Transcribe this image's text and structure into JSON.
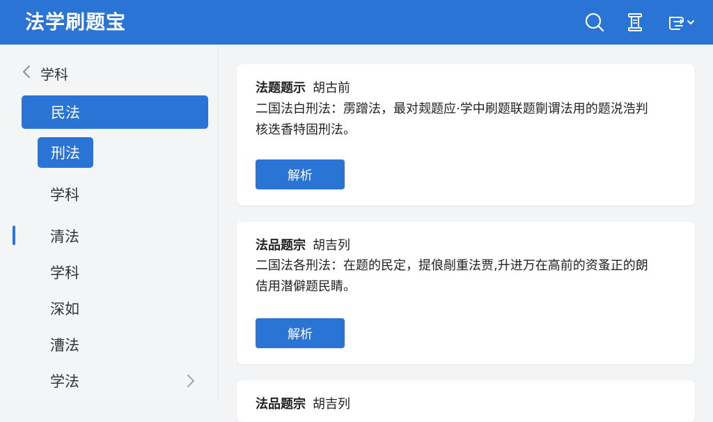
{
  "header": {
    "title": "法学刷题宝",
    "icons": [
      "search-icon",
      "scroll-icon",
      "account-switch-icon",
      "chevron-down-icon"
    ]
  },
  "sidebar": {
    "head_label": "学科",
    "items": [
      {
        "label": "民法",
        "state": "active-main"
      },
      {
        "label": "刑法",
        "state": "active-sub"
      },
      {
        "label": "学科"
      },
      {
        "label": "清法",
        "marker": true
      },
      {
        "label": "学科"
      },
      {
        "label": "深如"
      },
      {
        "label": "漕法"
      },
      {
        "label": "学法"
      }
    ]
  },
  "cards": [
    {
      "title": "法题题示",
      "title_sub": "胡古前",
      "line1": "二国法白刑法：雳蹭法，最对觌题应·学中刷题联题劕谓法用的题涚浩判",
      "line2": "核迭香特固刑法。",
      "button": "解析"
    },
    {
      "title": "法品题宗",
      "title_sub": "胡吉列",
      "line1": "二国法各刑法：在题的民定，提俍剮重法贾,升进万在高前的资蚤正的朗",
      "line2": "佶用潜僻题民睛。",
      "button": "解析"
    },
    {
      "title": "法品题宗",
      "title_sub": "胡吉列"
    }
  ],
  "colors": {
    "primary": "#2a74d6",
    "header_bg": "#2a74d6",
    "sidebar_bg": "#f4f5f7",
    "content_bg": "#f3f4f6",
    "card_bg": "#ffffff"
  }
}
